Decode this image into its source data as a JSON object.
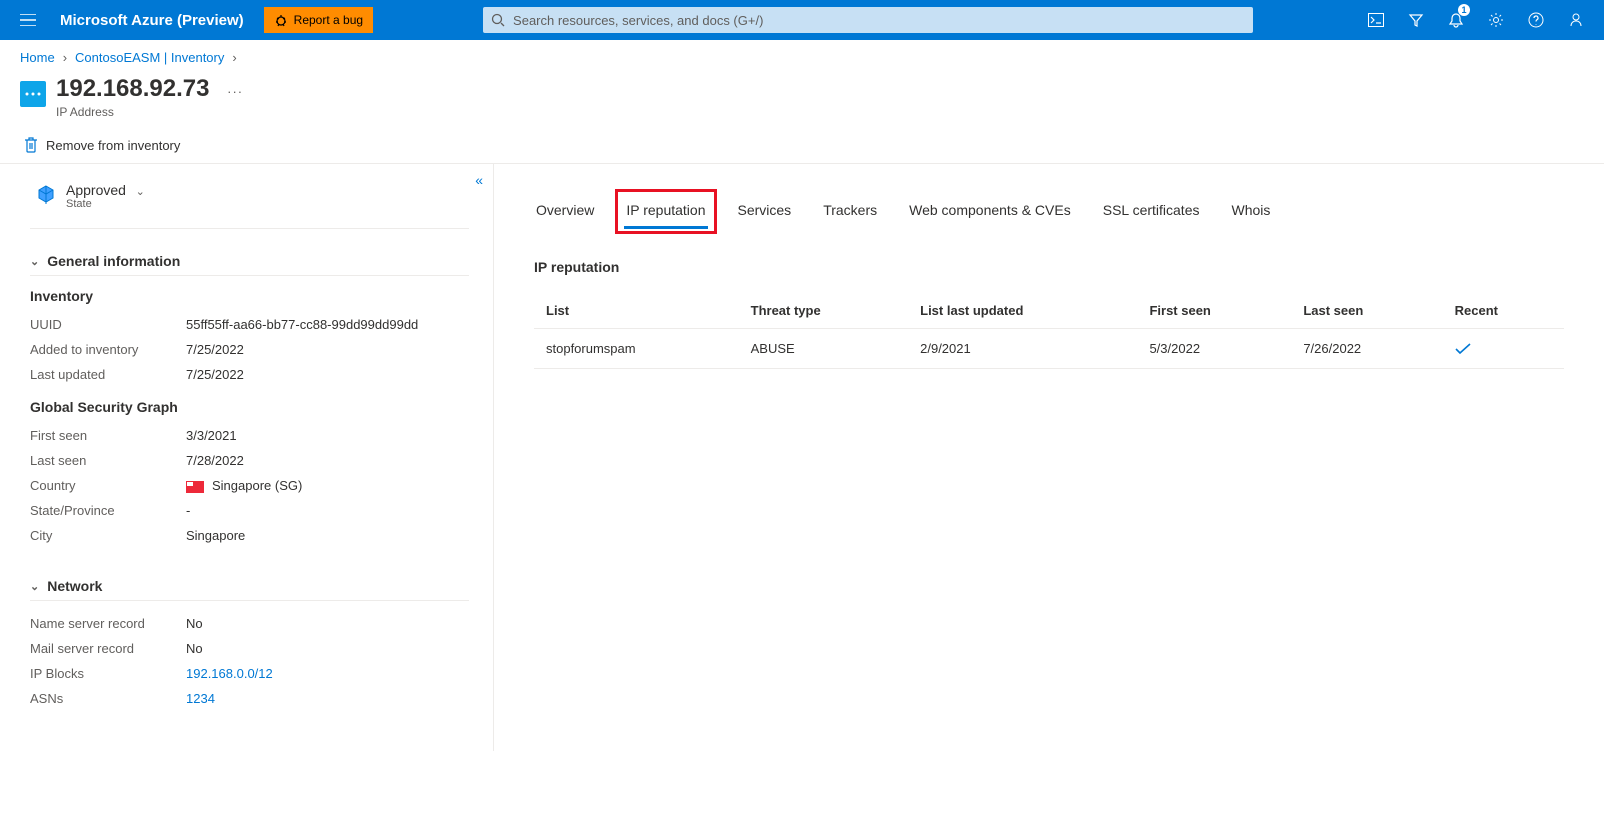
{
  "topbar": {
    "brand": "Microsoft Azure (Preview)",
    "bug_label": "Report a bug",
    "search_placeholder": "Search resources, services, and docs (G+/)",
    "notification_count": "1"
  },
  "breadcrumb": {
    "items": [
      "Home",
      "ContosoEASM | Inventory"
    ]
  },
  "page": {
    "title": "192.168.92.73",
    "subtitle": "IP Address",
    "more": "···"
  },
  "commands": {
    "remove": "Remove from inventory"
  },
  "state": {
    "label": "Approved",
    "sub": "State"
  },
  "sections": {
    "general": {
      "title": "General information",
      "inventory": {
        "heading": "Inventory",
        "rows": [
          {
            "k": "UUID",
            "v": "55ff55ff-aa66-bb77-cc88-99dd99dd99dd"
          },
          {
            "k": "Added to inventory",
            "v": "7/25/2022"
          },
          {
            "k": "Last updated",
            "v": "7/25/2022"
          }
        ]
      },
      "gsg": {
        "heading": "Global Security Graph",
        "rows": [
          {
            "k": "First seen",
            "v": "3/3/2021"
          },
          {
            "k": "Last seen",
            "v": "7/28/2022"
          },
          {
            "k": "Country",
            "v": "Singapore (SG)",
            "flag": true
          },
          {
            "k": "State/Province",
            "v": "-"
          },
          {
            "k": "City",
            "v": "Singapore"
          }
        ]
      }
    },
    "network": {
      "title": "Network",
      "rows": [
        {
          "k": "Name server record",
          "v": "No"
        },
        {
          "k": "Mail server record",
          "v": "No"
        },
        {
          "k": "IP Blocks",
          "v": "192.168.0.0/12",
          "link": true
        },
        {
          "k": "ASNs",
          "v": "1234",
          "link": true
        }
      ]
    }
  },
  "tabs": [
    "Overview",
    "IP reputation",
    "Services",
    "Trackers",
    "Web components & CVEs",
    "SSL certificates",
    "Whois"
  ],
  "active_tab": "IP reputation",
  "panel": {
    "title": "IP reputation",
    "columns": [
      "List",
      "Threat type",
      "List last updated",
      "First seen",
      "Last seen",
      "Recent"
    ],
    "rows": [
      {
        "list": "stopforumspam",
        "threat": "ABUSE",
        "updated": "2/9/2021",
        "first": "5/3/2022",
        "last": "7/26/2022",
        "recent": true
      }
    ]
  }
}
